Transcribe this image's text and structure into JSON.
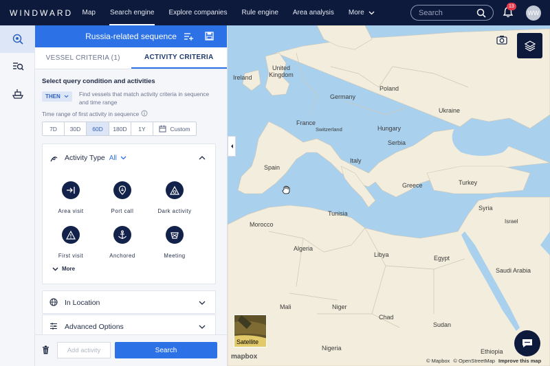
{
  "topbar": {
    "logo": "WINDWARD",
    "nav": [
      {
        "label": "Map"
      },
      {
        "label": "Search engine",
        "active": true
      },
      {
        "label": "Explore companies"
      },
      {
        "label": "Rule engine"
      },
      {
        "label": "Area analysis"
      },
      {
        "label": "More"
      }
    ],
    "search_placeholder": "Search",
    "notification_count": "13",
    "avatar_initials": "WW"
  },
  "panel": {
    "title": "Russia-related sequence",
    "tabs": [
      "VESSEL CRITERIA (1)",
      "ACTIVITY CRITERIA"
    ],
    "active_tab": "ACTIVITY CRITERIA",
    "section_title": "Select query condition and activities",
    "condition": "THEN",
    "condition_desc": "Find vessels that match activity criteria in sequence and time range",
    "range_label": "Time range of first activity in sequence",
    "ranges": [
      "7D",
      "30D",
      "60D",
      "180D",
      "1Y",
      "Custom"
    ],
    "selected_range": "60D",
    "activity_type_label": "Activity Type",
    "activity_type_value": "All",
    "activities": [
      "Area visit",
      "Port call",
      "Dark activity",
      "First visit",
      "Anchored",
      "Meeting"
    ],
    "more_label": "More",
    "in_location_label": "In Location",
    "advanced_label": "Advanced Options",
    "add_activity_label": "Add activity",
    "search_label": "Search"
  },
  "map": {
    "labels": [
      "Ireland",
      "United Kingdom",
      "Poland",
      "Germany",
      "Ukraine",
      "France",
      "Switzerland",
      "Hungary",
      "Serbia",
      "Italy",
      "Spain",
      "Greece",
      "Turkey",
      "Morocco",
      "Tunisia",
      "Syria",
      "Israel",
      "Algeria",
      "Libya",
      "Egypt",
      "Saudi Arabia",
      "Mali",
      "Niger",
      "Chad",
      "Sudan",
      "Nigeria",
      "Ethiopia"
    ],
    "satellite_label": "Satellite",
    "mapbox_label": "mapbox",
    "attribution": [
      "© Mapbox",
      "© OpenStreetMap",
      "Improve this map"
    ]
  },
  "colors": {
    "brand": "#0d1a3c",
    "accent": "#2c72e6",
    "water": "#a9d1ee",
    "land": "#f3eddd"
  }
}
